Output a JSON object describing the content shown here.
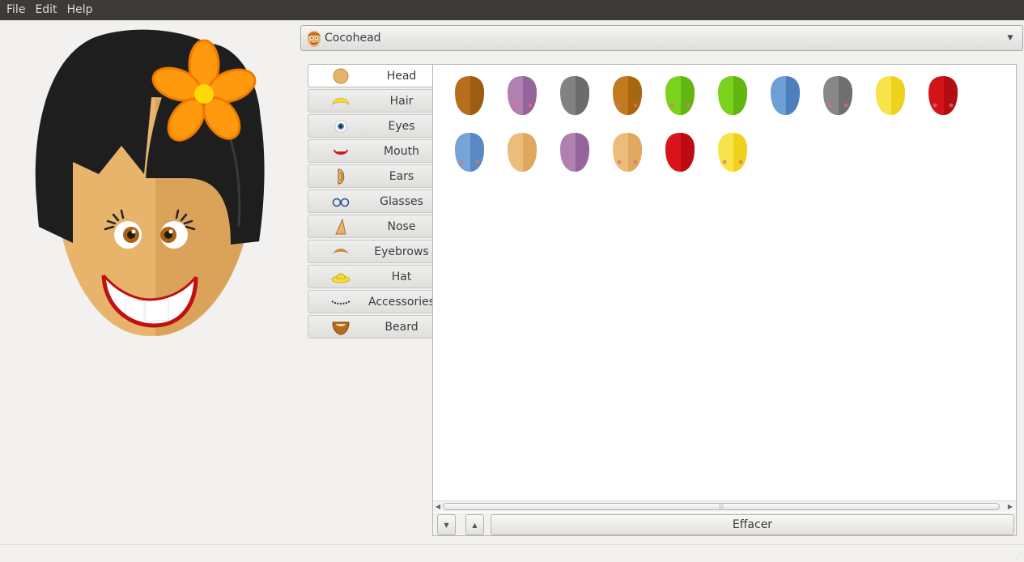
{
  "menu": {
    "items": [
      "File",
      "Edit",
      "Help"
    ]
  },
  "selector": {
    "value": "Cocohead",
    "icon": "cocohead-face-icon"
  },
  "tabs": [
    {
      "label": "Head",
      "icon": "head-icon",
      "active": true
    },
    {
      "label": "Hair",
      "icon": "hair-icon",
      "active": false
    },
    {
      "label": "Eyes",
      "icon": "eye-icon",
      "active": false
    },
    {
      "label": "Mouth",
      "icon": "mouth-icon",
      "active": false
    },
    {
      "label": "Ears",
      "icon": "ear-icon",
      "active": false
    },
    {
      "label": "Glasses",
      "icon": "glasses-icon",
      "active": false
    },
    {
      "label": "Nose",
      "icon": "nose-icon",
      "active": false
    },
    {
      "label": "Eyebrows",
      "icon": "eyebrow-icon",
      "active": false
    },
    {
      "label": "Hat",
      "icon": "hat-icon",
      "active": false
    },
    {
      "label": "Accessories",
      "icon": "accessories-icon",
      "active": false
    },
    {
      "label": "Beard",
      "icon": "beard-icon",
      "active": false
    }
  ],
  "head_options": [
    {
      "light": "#b56e1c",
      "dark": "#9c5c12",
      "cheeks": false
    },
    {
      "light": "#b080b0",
      "dark": "#94649a",
      "cheeks": true
    },
    {
      "light": "#828282",
      "dark": "#6c6c6c",
      "cheeks": false
    },
    {
      "light": "#c27a1e",
      "dark": "#a8660f",
      "cheeks": true
    },
    {
      "light": "#7ad21d",
      "dark": "#62b612",
      "cheeks": true
    },
    {
      "light": "#7ad21d",
      "dark": "#62b612",
      "cheeks": false
    },
    {
      "light": "#6f9ed6",
      "dark": "#4d7fbf",
      "cheeks": false
    },
    {
      "light": "#878787",
      "dark": "#6f6f6f",
      "cheeks": true
    },
    {
      "light": "#f8e44a",
      "dark": "#eed21c",
      "cheeks": false
    },
    {
      "light": "#d21419",
      "dark": "#b30d12",
      "cheeks": true
    },
    {
      "light": "#76a3d8",
      "dark": "#5a88c4",
      "cheeks": true
    },
    {
      "light": "#ecbd7a",
      "dark": "#dfa85e",
      "cheeks": false
    },
    {
      "light": "#b080b0",
      "dark": "#94649a",
      "cheeks": false
    },
    {
      "light": "#ecbd7a",
      "dark": "#dfa85e",
      "cheeks": true
    },
    {
      "light": "#d8141a",
      "dark": "#bd0b12",
      "cheeks": false
    },
    {
      "light": "#f8e44a",
      "dark": "#eed21c",
      "cheeks": true
    }
  ],
  "controls": {
    "clear_label": "Effacer"
  },
  "colors": {
    "accent_flower": "#ff9a0e",
    "hair": "#222222",
    "skin": "#e8b36c"
  }
}
